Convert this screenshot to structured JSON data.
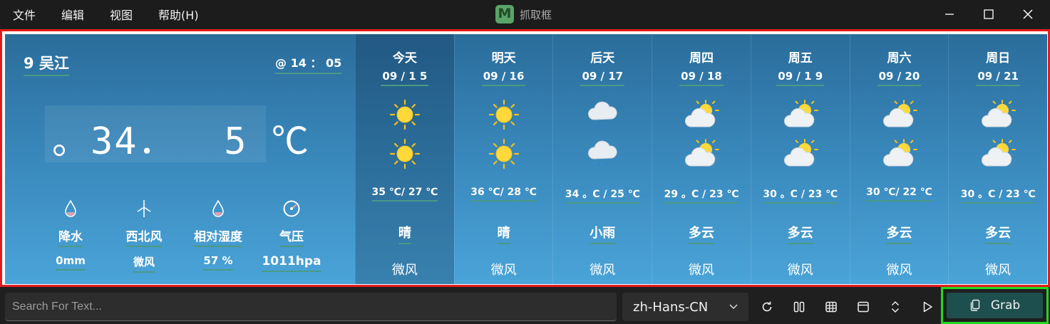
{
  "menu": {
    "file": "文件",
    "edit": "编辑",
    "view": "视图",
    "help": "帮助(H)"
  },
  "app": {
    "title": "抓取框",
    "logo_letter": "M"
  },
  "weather": {
    "city": "9 吴江",
    "time": "@ 14 ： 05",
    "temperature": "。34．  5 ℃",
    "stats": [
      {
        "icon": "raindrop-icon",
        "label": "降水",
        "value": "0mm"
      },
      {
        "icon": "wind-turbine-icon",
        "label": "西北风",
        "value": "微风"
      },
      {
        "icon": "humidity-drop-icon",
        "label": "相对湿度",
        "value": "57 %"
      },
      {
        "icon": "gauge-icon",
        "label": "气压",
        "value": "1011hpa"
      }
    ],
    "days": [
      {
        "name": "今天",
        "date": "09 / 1 5",
        "day_icon": "sun-icon",
        "night_icon": "sun-icon",
        "range": "35 ℃/ 27 ℃",
        "condition": "晴",
        "wind": "微风"
      },
      {
        "name": "明天",
        "date": "09 / 16",
        "day_icon": "sun-icon",
        "night_icon": "sun-icon",
        "range": "36 ℃/ 28 ℃",
        "condition": "晴",
        "wind": "微风"
      },
      {
        "name": "后天",
        "date": "09 / 17",
        "day_icon": "rain-cloud-icon",
        "night_icon": "rain-cloud-icon",
        "range": "34 。C / 25 ℃",
        "condition": "小雨",
        "wind": "微风"
      },
      {
        "name": "周四",
        "date": "09 / 18",
        "day_icon": "partly-cloudy-icon",
        "night_icon": "partly-cloudy-icon",
        "range": "29 。C / 23 ℃",
        "condition": "多云",
        "wind": "微风"
      },
      {
        "name": "周五",
        "date": "09 / 1 9",
        "day_icon": "partly-cloudy-icon",
        "night_icon": "partly-cloudy-icon",
        "range": "30 。C / 23 ℃",
        "condition": "多云",
        "wind": "微风"
      },
      {
        "name": "周六",
        "date": "09 / 20",
        "day_icon": "partly-cloudy-icon",
        "night_icon": "partly-cloudy-icon",
        "range": "30 ℃/ 22 ℃",
        "condition": "多云",
        "wind": "微风"
      },
      {
        "name": "周日",
        "date": "09 / 21",
        "day_icon": "partly-cloudy-icon",
        "night_icon": "partly-cloudy-icon",
        "range": "30 。C / 23 ℃",
        "condition": "多云",
        "wind": "微风"
      }
    ]
  },
  "toolbar": {
    "search_placeholder": "Search For Text...",
    "language": "zh-Hans-CN",
    "grab_label": "Grab"
  },
  "colors": {
    "frame": "#e51b1b",
    "grab_highlight": "#22d81f",
    "grab_bg": "#1e4f4f",
    "underline": "#4a9a86"
  }
}
